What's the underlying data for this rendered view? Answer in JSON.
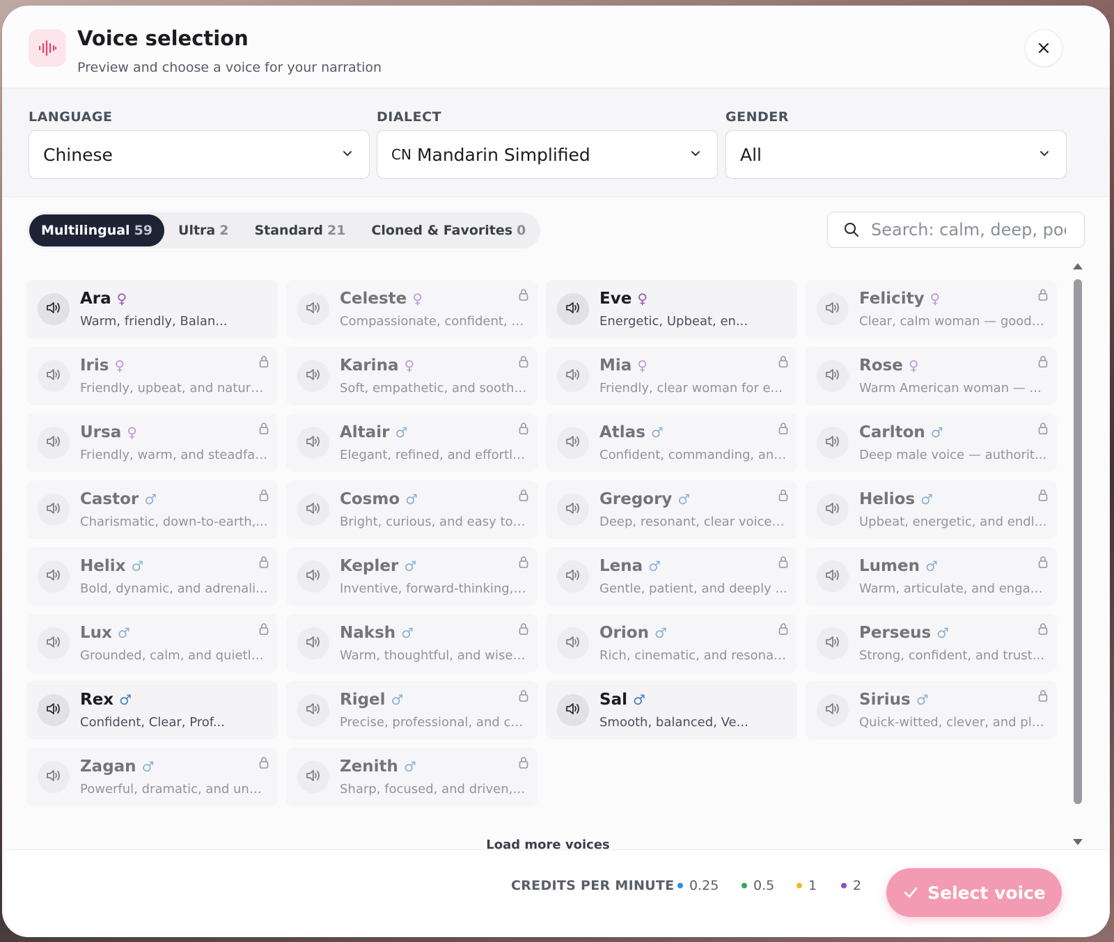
{
  "header": {
    "title": "Voice selection",
    "subtitle": "Preview and choose a voice for your narration",
    "logo_icon": "waveform-icon",
    "close_icon": "close-icon"
  },
  "filters": {
    "language": {
      "label": "LANGUAGE",
      "value": "Chinese"
    },
    "dialect": {
      "label": "DIALECT",
      "prefix": "CN",
      "value": "Mandarin Simplified"
    },
    "gender": {
      "label": "GENDER",
      "value": "All"
    }
  },
  "tabs": [
    {
      "label": "Multilingual",
      "count": "59",
      "active": true
    },
    {
      "label": "Ultra",
      "count": "2",
      "active": false
    },
    {
      "label": "Standard",
      "count": "21",
      "active": false
    },
    {
      "label": "Cloned & Favorites",
      "count": "0",
      "active": false
    }
  ],
  "search": {
    "placeholder": "Search: calm, deep, podcast"
  },
  "voices": [
    {
      "name": "Ara",
      "gender": "female",
      "desc": "Warm, friendly, Balan...",
      "locked": false
    },
    {
      "name": "Celeste",
      "gender": "female",
      "desc": "Compassionate, confident, a...",
      "locked": true
    },
    {
      "name": "Eve",
      "gender": "female",
      "desc": "Energetic, Upbeat, en...",
      "locked": false
    },
    {
      "name": "Felicity",
      "gender": "female",
      "desc": "Clear, calm woman — good ...",
      "locked": true
    },
    {
      "name": "Iris",
      "gender": "female",
      "desc": "Friendly, upbeat, and natural...",
      "locked": true
    },
    {
      "name": "Karina",
      "gender": "female",
      "desc": "Soft, empathetic, and soothi...",
      "locked": true
    },
    {
      "name": "Mia",
      "gender": "female",
      "desc": "Friendly, clear woman for ex...",
      "locked": true
    },
    {
      "name": "Rose",
      "gender": "female",
      "desc": "Warm American woman — ...",
      "locked": true
    },
    {
      "name": "Ursa",
      "gender": "female",
      "desc": "Friendly, warm, and steadfas...",
      "locked": true
    },
    {
      "name": "Altair",
      "gender": "male",
      "desc": "Elegant, refined, and effortle...",
      "locked": true
    },
    {
      "name": "Atlas",
      "gender": "male",
      "desc": "Confident, commanding, and...",
      "locked": true
    },
    {
      "name": "Carlton",
      "gender": "male",
      "desc": "Deep male voice — authorit...",
      "locked": true
    },
    {
      "name": "Castor",
      "gender": "male",
      "desc": "Charismatic, down-to-earth,...",
      "locked": true
    },
    {
      "name": "Cosmo",
      "gender": "male",
      "desc": "Bright, curious, and easy to f...",
      "locked": true
    },
    {
      "name": "Gregory",
      "gender": "male",
      "desc": "Deep, resonant, clear voice f...",
      "locked": true
    },
    {
      "name": "Helios",
      "gender": "male",
      "desc": "Upbeat, energetic, and endle...",
      "locked": true
    },
    {
      "name": "Helix",
      "gender": "male",
      "desc": "Bold, dynamic, and adrenali...",
      "locked": true
    },
    {
      "name": "Kepler",
      "gender": "male",
      "desc": "Inventive, forward-thinking, ...",
      "locked": true
    },
    {
      "name": "Lena",
      "gender": "male",
      "desc": "Gentle, patient, and deeply ...",
      "locked": true
    },
    {
      "name": "Lumen",
      "gender": "male",
      "desc": "Warm, articulate, and engag...",
      "locked": true
    },
    {
      "name": "Lux",
      "gender": "male",
      "desc": "Grounded, calm, and quietly ...",
      "locked": true
    },
    {
      "name": "Naksh",
      "gender": "male",
      "desc": "Warm, thoughtful, and wise,...",
      "locked": true
    },
    {
      "name": "Orion",
      "gender": "male",
      "desc": "Rich, cinematic, and resonan...",
      "locked": true
    },
    {
      "name": "Perseus",
      "gender": "male",
      "desc": "Strong, confident, and trust...",
      "locked": true
    },
    {
      "name": "Rex",
      "gender": "male",
      "desc": "Confident, Clear, Prof...",
      "locked": false
    },
    {
      "name": "Rigel",
      "gender": "male",
      "desc": "Precise, professional, and cal...",
      "locked": true
    },
    {
      "name": "Sal",
      "gender": "male",
      "desc": "Smooth, balanced, Ve...",
      "locked": false
    },
    {
      "name": "Sirius",
      "gender": "male",
      "desc": "Quick-witted, clever, and pla...",
      "locked": true
    },
    {
      "name": "Zagan",
      "gender": "male",
      "desc": "Powerful, dramatic, and unm...",
      "locked": true
    },
    {
      "name": "Zenith",
      "gender": "male",
      "desc": "Sharp, focused, and driven, S...",
      "locked": true
    }
  ],
  "load_more": "Load more voices",
  "footer": {
    "credits_label": "CREDITS PER MINUTE",
    "credits": [
      {
        "value": "0.25",
        "color": "#2f8df0"
      },
      {
        "value": "0.5",
        "color": "#3aa55a"
      },
      {
        "value": "1",
        "color": "#f2b62c"
      },
      {
        "value": "2",
        "color": "#8b4fc8"
      }
    ],
    "select_button": "Select voice"
  }
}
